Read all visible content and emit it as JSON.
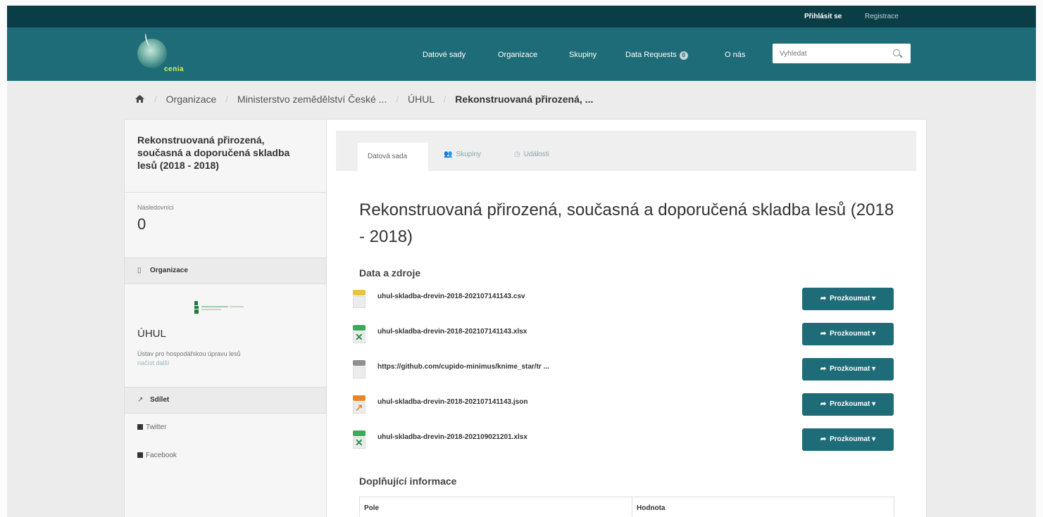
{
  "account": {
    "login": "Přihlásit se",
    "register": "Registrace"
  },
  "masthead": {
    "logo_text": "cenia",
    "nav": [
      {
        "label": "Datové sady"
      },
      {
        "label": "Organizace"
      },
      {
        "label": "Skupiny"
      },
      {
        "label": "Data Requests",
        "badge": "0"
      },
      {
        "label": "O nás"
      }
    ],
    "search_placeholder": "Vyhledat",
    "search_icon": "magnifier-icon"
  },
  "breadcrumb": {
    "home_icon": "home-icon",
    "items": [
      "Organizace",
      "Ministerstvo zemědělství České ...",
      "ÚHUL",
      "Rekonstruovaná přirozená, ..."
    ]
  },
  "sidebar": {
    "title": "Rekonstruovaná přirozená, současná a doporučená skladba lesů (2018 - 2018)",
    "followers_label": "Následovníci",
    "followers_count": "0",
    "org_section_label": "Organizace",
    "org_name": "ÚHUL",
    "org_description": "Ústav pro hospodářskou úpravu lesů",
    "org_more": "načíst další",
    "share_label": "Sdílet",
    "twitter": "Twitter",
    "facebook": "Facebook"
  },
  "tabs": [
    {
      "label": "Datová sada",
      "active": true
    },
    {
      "label": "Skupiny",
      "icon": "users-icon"
    },
    {
      "label": "Události",
      "icon": "clock-icon"
    }
  ],
  "dataset": {
    "title": "Rekonstruovaná přirozená, současná a doporučená skladba lesů (2018 - 2018)",
    "resources_title": "Data a zdroje",
    "explore_label": "Prozkoumat",
    "resources": [
      {
        "name": "uhul-skladba-drevin-2018-202107141143.csv",
        "format": "csv",
        "color": "#e8c33b"
      },
      {
        "name": "uhul-skladba-drevin-2018-202107141143.xlsx",
        "format": "xlsx",
        "color": "#3bab5b"
      },
      {
        "name": "https://github.com/cupido-minimus/knime_star/tr ...",
        "format": "link",
        "color": "#8f8f8f"
      },
      {
        "name": "uhul-skladba-drevin-2018-202107141143.json",
        "format": "json",
        "color": "#e6872b"
      },
      {
        "name": "uhul-skladba-drevin-2018-202109021201.xlsx",
        "format": "xlsx",
        "color": "#3bab5b"
      }
    ],
    "additional_title": "Doplňující informace",
    "table_headers": [
      "Pole",
      "Hodnota"
    ]
  }
}
